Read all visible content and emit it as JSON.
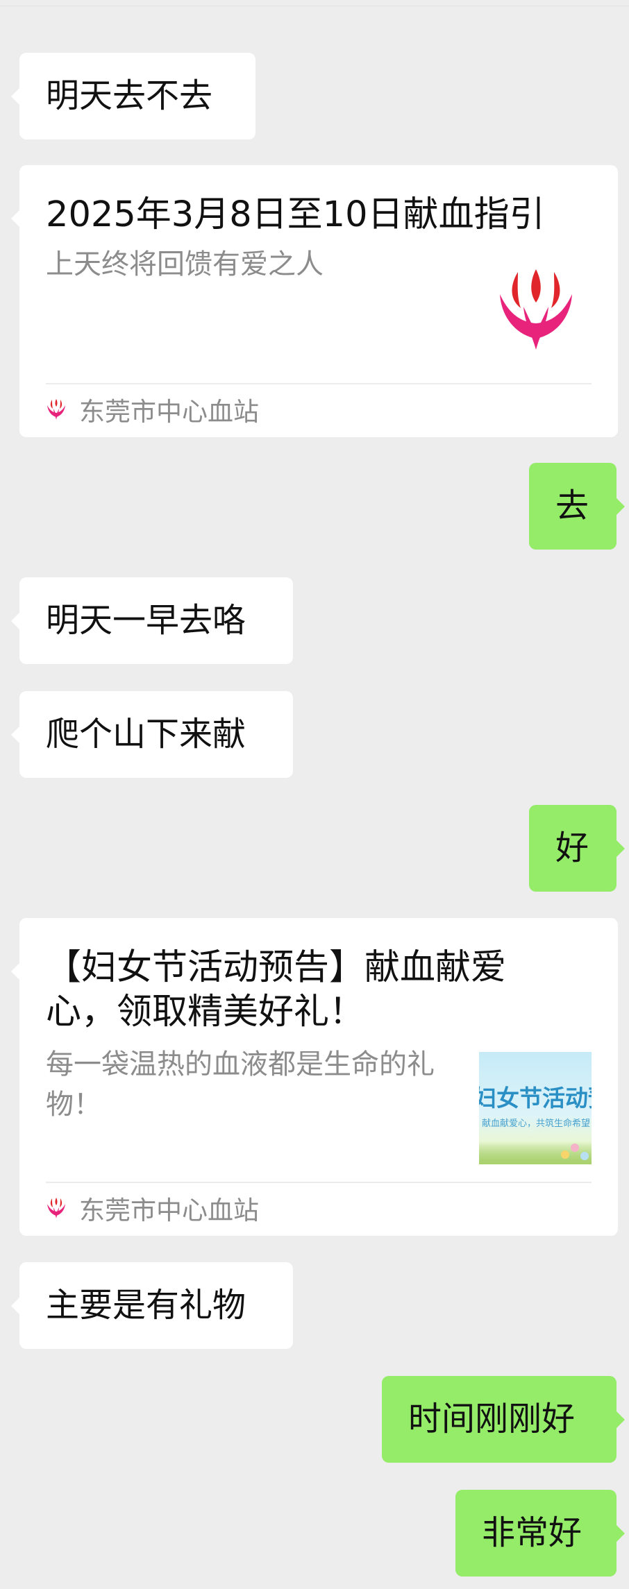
{
  "messages": [
    {
      "text": "明天去不去"
    },
    {
      "title": "2025年3月8日至10日献血指引",
      "desc": "上天终将回馈有爱之人",
      "source": "东莞市中心血站",
      "thumb_icon": "blood-station-logo-icon"
    },
    {
      "text": "去"
    },
    {
      "text": "明天一早去咯"
    },
    {
      "text": "爬个山下来献"
    },
    {
      "text": "好"
    },
    {
      "title": "【妇女节活动预告】献血献爱心，领取精美好礼！",
      "desc": "每一袋温热的血液都是生命的礼物！",
      "source": "东莞市中心血站",
      "thumb_text": "妇女节活动预告",
      "thumb_sub": "献血献爱心，共筑生命希望"
    },
    {
      "text": "主要是有礼物"
    },
    {
      "text": "时间刚刚好"
    },
    {
      "text": "非常好"
    }
  ],
  "colors": {
    "background": "#ededed",
    "incoming_bubble": "#ffffff",
    "outgoing_bubble": "#95ec69",
    "logo_pink": "#e8237c",
    "logo_red": "#e0262a"
  }
}
